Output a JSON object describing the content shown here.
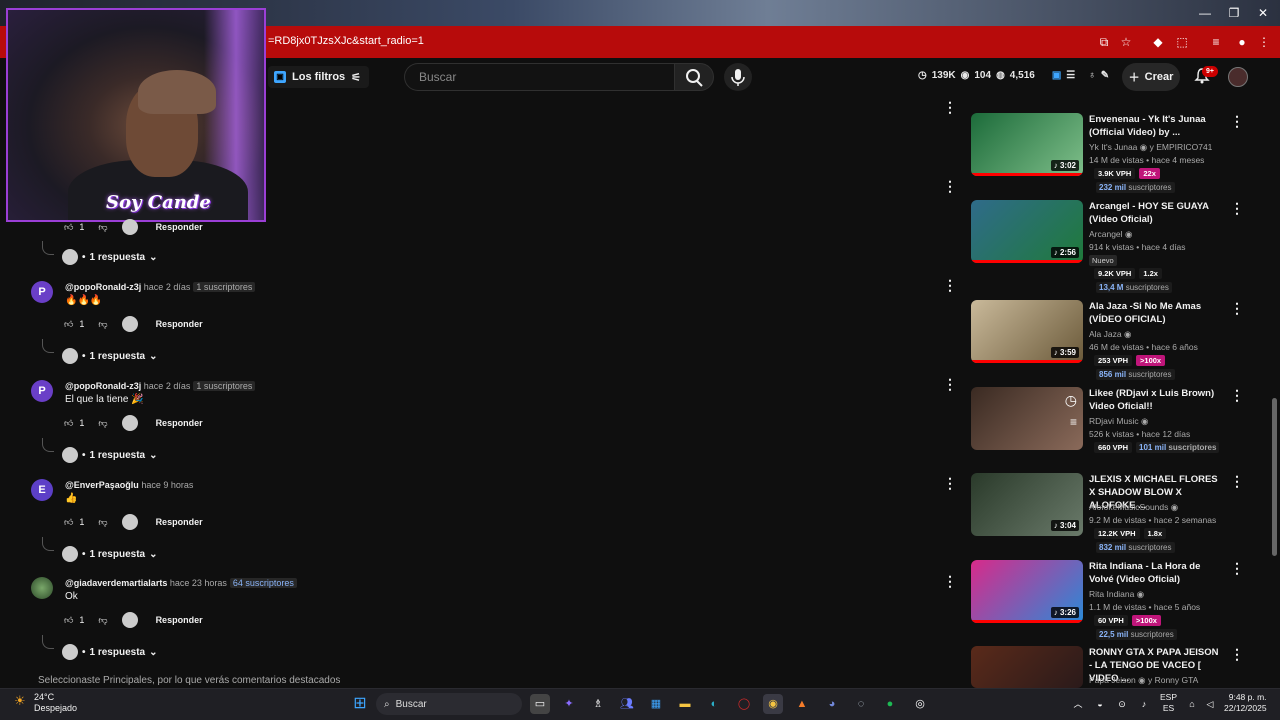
{
  "browser": {
    "url": "=RD8jx0TJzsXJc&start_radio=1"
  },
  "header": {
    "filters_label": "Los filtros",
    "search_placeholder": "Buscar",
    "stats": {
      "views": "139K",
      "watchers": "104",
      "likes": "4,516"
    },
    "create_label": "Crear",
    "notif_count": "9+"
  },
  "webcam": {
    "logo_text": "Soy Cande"
  },
  "comments": [
    {
      "avatar": "P",
      "avatar_color": "#6a3fc7",
      "author": "@popoRonald-z3j",
      "time": "hace 2 días",
      "subs": "1 suscriptores",
      "text": "🔥🔥🔥",
      "likes": "1",
      "reply_label": "Responder",
      "replies": "1 respuesta"
    },
    {
      "avatar": "P",
      "avatar_color": "#6a3fc7",
      "author": "@popoRonald-z3j",
      "time": "hace 2 días",
      "subs": "1 suscriptores",
      "text": "El que la tiene 🎉",
      "likes": "1",
      "reply_label": "Responder",
      "replies": "1 respuesta"
    },
    {
      "avatar": "E",
      "avatar_color": "#5c3fc7",
      "author": "@EnverPaşaoğlu",
      "time": "hace 9 horas",
      "subs": "",
      "text": "👍",
      "likes": "1",
      "reply_label": "Responder",
      "replies": "1 respuesta"
    },
    {
      "avatar": "",
      "avatar_color": "#3d5a3a",
      "author": "@giadaverdemartialarts",
      "time": "hace 23 horas",
      "subs": "64 suscriptores",
      "text": "Ok",
      "likes": "1",
      "reply_label": "Responder",
      "replies": "1 respuesta"
    }
  ],
  "top_comment": {
    "likes": "1",
    "reply_label": "Responder",
    "replies": "1 respuesta"
  },
  "footer_note": "Seleccionaste Principales, por lo que verás comentarios destacados",
  "videos": [
    {
      "title": "Envenenau - Yk It's Junaa (Official Video) by ...",
      "channel": "Yk It's Junaa",
      "channel_extra": "y EMPIRICO741",
      "stats": "14 M de vistas • hace 4 meses",
      "duration": "3:02",
      "vph": "3.9K VPH",
      "mult": "22x",
      "mult_hot": true,
      "subs_num": "232 mil",
      "subs_word": "suscriptores",
      "nuevo": "",
      "thumb_colors": [
        "#1c6b3a",
        "#7fbf8a"
      ]
    },
    {
      "title": "Arcangel - HOY SE GUAYA (Video Oficial)",
      "channel": "Arcangel",
      "channel_extra": "",
      "stats": "914 k vistas • hace 4 días",
      "duration": "2:56",
      "vph": "9.2K VPH",
      "mult": "1.2x",
      "mult_hot": false,
      "subs_num": "13,4 M",
      "subs_word": "suscriptores",
      "nuevo": "Nuevo",
      "thumb_colors": [
        "#2f6b8a",
        "#1f7a3a"
      ]
    },
    {
      "title": "Ala Jaza -Si No Me Amas (VÍDEO OFICIAL)",
      "channel": "Ala Jaza",
      "channel_extra": "",
      "stats": "46 M de vistas • hace 6 años",
      "duration": "3:59",
      "vph": "253 VPH",
      "mult": ">100x",
      "mult_hot": true,
      "subs_num": "856 mil",
      "subs_word": "suscriptores",
      "nuevo": "",
      "thumb_colors": [
        "#c9b99a",
        "#6b5a3a"
      ]
    },
    {
      "title": "Likee (RDjavi x Luis Brown) Video Oficial!!",
      "channel": "RDjavi Music",
      "channel_extra": "",
      "stats": "526 k vistas • hace 12 días",
      "duration": "",
      "vph": "660 VPH",
      "mult": "",
      "mult_hot": false,
      "subs_num": "101 mil",
      "subs_word": "suscriptores",
      "nuevo": "",
      "thumb_colors": [
        "#3a2a22",
        "#8a6a5a"
      ]
    },
    {
      "title": "JLEXIS X MICHAEL FLORES X SHADOW BLOW X ALOFOKE ...",
      "channel": "AlofokeMusicSounds",
      "channel_extra": "",
      "stats": "9.2 M de vistas • hace 2 semanas",
      "duration": "3:04",
      "vph": "12.2K VPH",
      "mult": "1.8x",
      "mult_hot": false,
      "subs_num": "832 mil",
      "subs_word": "suscriptores",
      "nuevo": "",
      "thumb_colors": [
        "#2a3a2a",
        "#6a7a6a"
      ]
    },
    {
      "title": "Rita Indiana - La Hora de Volvé (Video Oficial)",
      "channel": "Rita Indiana",
      "channel_extra": "",
      "stats": "1.1 M de vistas • hace 5 años",
      "duration": "3:26",
      "vph": "60 VPH",
      "mult": ">100x",
      "mult_hot": true,
      "subs_num": "22,5 mil",
      "subs_word": "suscriptores",
      "nuevo": "",
      "thumb_colors": [
        "#d82a8a",
        "#2a8ad8"
      ]
    },
    {
      "title": "RONNY GTA X PAPA JEISON - LA TENGO DE VACEO [ VIDEO ...",
      "channel": "Papa Jeison",
      "channel_extra": "y Ronny GTA",
      "stats": "",
      "duration": "",
      "vph": "",
      "mult": "",
      "mult_hot": false,
      "subs_num": "",
      "subs_word": "",
      "nuevo": "",
      "thumb_colors": [
        "#5a2a1a",
        "#2a1a1a"
      ]
    }
  ],
  "taskbar": {
    "weather_temp": "24°C",
    "weather_desc": "Despejado",
    "search_label": "Buscar",
    "lang_top": "ESP",
    "lang_bottom": "ES",
    "time": "9:48 p. m.",
    "date": "22/12/2025"
  },
  "colors": {
    "accent_red": "#b70b0b",
    "subs_blue": "#8ab4f8",
    "hot_pill": "#c0157a"
  }
}
